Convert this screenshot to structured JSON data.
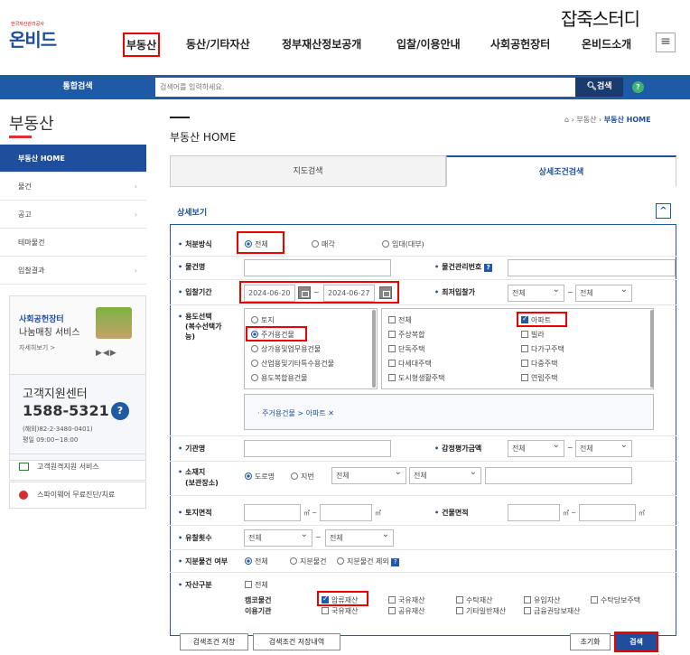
{
  "watermark": "잡죽스터디",
  "logo": {
    "small": "한국자산관리공사",
    "text": "온비드"
  },
  "nav": [
    "부동산",
    "동산/기타자산",
    "정부재산정보공개",
    "입찰/이용안내",
    "사회공헌장터",
    "온비드소개"
  ],
  "search": {
    "label": "통합검색",
    "placeholder": "검색어를 입력하세요.",
    "button": "검색"
  },
  "sidebar": {
    "title": "부동산",
    "items": [
      {
        "label": "부동산 HOME",
        "chevron": ""
      },
      {
        "label": "물건",
        "chevron": "›"
      },
      {
        "label": "공고",
        "chevron": "›"
      },
      {
        "label": "테마물건",
        "chevron": ""
      },
      {
        "label": "입찰결과",
        "chevron": "›"
      }
    ],
    "promo": {
      "title1": "사회공헌장터",
      "title2": "나눔매칭 서비스",
      "more": "자세히보기 >"
    },
    "cs": {
      "title": "고객지원센터",
      "phone": "1588-5321",
      "overseas": "(해외)82-2-3480-0401)",
      "hours": "평일 09:00~18:00"
    },
    "btn1": "고객원격지원 서비스",
    "btn2": "스파이웨어 무료진단/치료"
  },
  "main": {
    "title": "부동산 HOME",
    "breadcrumb": {
      "sep1": "›",
      "parent": "부동산",
      "sep2": "›",
      "current": "부동산 HOME"
    },
    "tabs": [
      "지도검색",
      "상세조건검색"
    ],
    "panel": "상세보기",
    "disposal": {
      "label": "처분방식",
      "options": [
        "전체",
        "매각",
        "임대(대부)"
      ]
    },
    "item_name": {
      "label": "물건명"
    },
    "item_no": {
      "label": "물건관리번호",
      "help": "?"
    },
    "bid_period": {
      "label": "입찰기간",
      "from": "2024-06-20",
      "tilde": "~",
      "to": "2024-06-27"
    },
    "min_price": {
      "label": "최저입찰가",
      "sel1": "전체",
      "tilde": "~",
      "sel2": "전체"
    },
    "use": {
      "label1": "용도선택",
      "label2": "(복수선택가",
      "label3": "능)",
      "left": [
        "토지",
        "주거용건물",
        "상가용및업무용건물",
        "산업용및기타특수용건물",
        "용도복합용건물"
      ],
      "mid": [
        "전체",
        "주상복합",
        "단독주택",
        "다세대주택",
        "도시형생활주택"
      ],
      "right": [
        "아파트",
        "빌라",
        "다가구주택",
        "다중주택",
        "연립주택"
      ],
      "selected": "· 주거용건물 > 아파트 ✕"
    },
    "agency": {
      "label": "기관명"
    },
    "appraisal": {
      "label": "감정평가금액",
      "sel1": "전체",
      "tilde": "~",
      "sel2": "전체"
    },
    "location": {
      "label1": "소재지",
      "label2": "(보관장소)",
      "r1": "도로명",
      "r2": "지번",
      "s1": "전체",
      "s2": "전체"
    },
    "land_area": {
      "label": "토지면적",
      "unit": "㎡",
      "tilde": "~"
    },
    "bldg_area": {
      "label": "건물면적",
      "unit": "㎡",
      "tilde": "~"
    },
    "fail_count": {
      "label": "유찰횟수",
      "sel1": "전체",
      "tilde": "~",
      "sel2": "전체"
    },
    "share": {
      "label": "지분물건 여부",
      "options": [
        "전체",
        "지분물건",
        "지분물건 제외"
      ],
      "help": "?"
    },
    "asset": {
      "label": "자산구분",
      "all": "전체",
      "row1_label": "캠코물건",
      "row2_label": "이용기관",
      "row1": [
        "압류재산",
        "국유재산",
        "수탁재산",
        "유입자산",
        "수탁당보주택"
      ],
      "row2": [
        "국유재산",
        "공유재산",
        "기타일반재산",
        "금융권담보재산"
      ]
    },
    "buttons": {
      "save": "검색조건 저장",
      "history": "검색조건 저장내역",
      "reset": "초기화",
      "search": "검색"
    }
  }
}
